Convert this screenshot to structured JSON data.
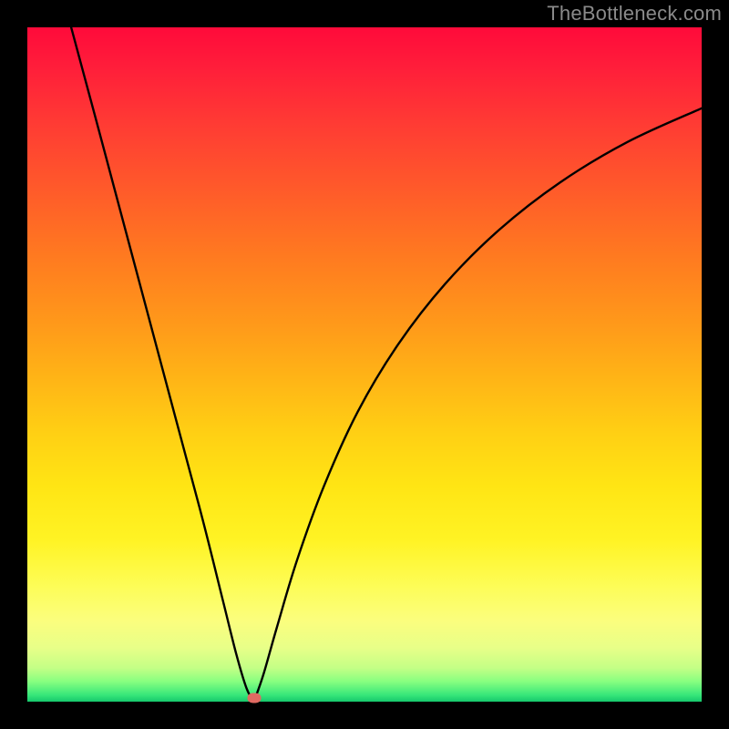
{
  "watermark": "TheBottleneck.com",
  "colors": {
    "frame": "#000000",
    "curve": "#000000",
    "marker": "#e06a62",
    "watermark": "#8a8a8a"
  },
  "chart_data": {
    "type": "line",
    "title": "",
    "xlabel": "",
    "ylabel": "",
    "xlim": [
      0,
      100
    ],
    "ylim": [
      0,
      100
    ],
    "grid": false,
    "legend": false,
    "annotations": [
      "TheBottleneck.com"
    ],
    "series": [
      {
        "name": "bottleneck-curve-left",
        "x": [
          6.5,
          10,
          14,
          18,
          22,
          26,
          29,
          31,
          32.5,
          33.6
        ],
        "y": [
          100,
          87,
          72,
          57,
          42,
          27,
          15,
          7,
          2,
          0
        ]
      },
      {
        "name": "bottleneck-curve-right",
        "x": [
          33.6,
          35,
          37,
          40,
          44,
          49,
          55,
          62,
          70,
          79,
          89,
          100
        ],
        "y": [
          0,
          4,
          11,
          21,
          32,
          43,
          53,
          62,
          70,
          77,
          83,
          88
        ]
      }
    ],
    "marker": {
      "x": 33.6,
      "y": 0.5
    },
    "notes": "Values estimated from pixel positions; the curve is a V-shaped bottleneck profile with minimum near x≈33.6."
  }
}
